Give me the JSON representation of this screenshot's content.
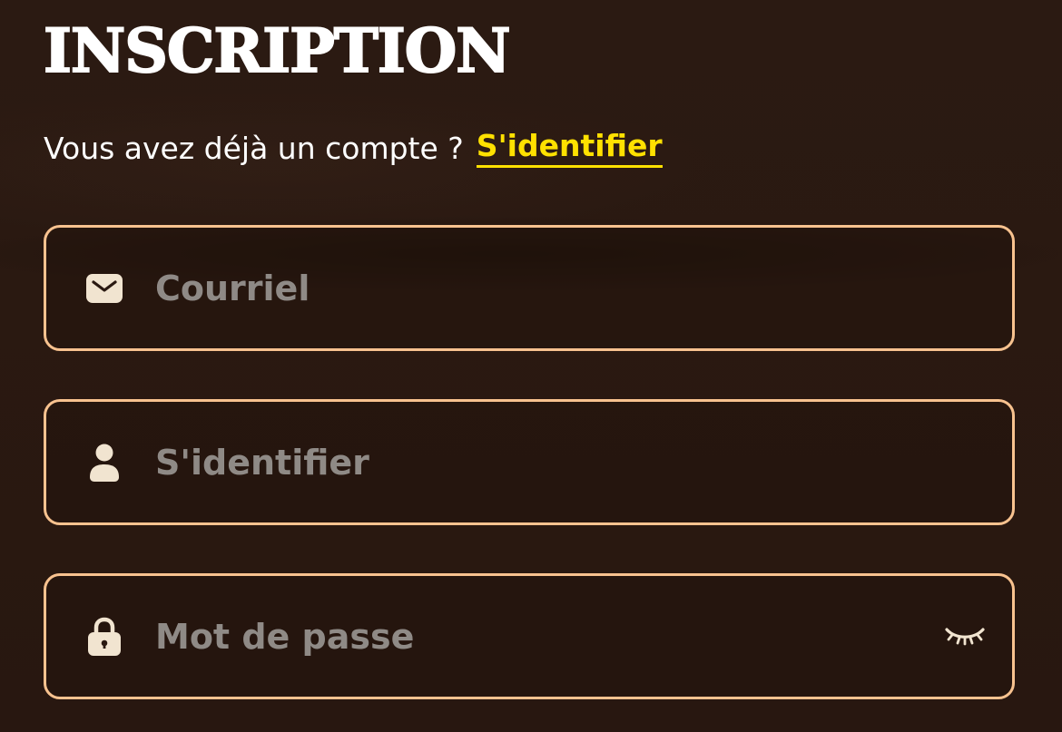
{
  "form": {
    "title": "INSCRIPTION",
    "login_prompt": "Vous avez déjà un compte ?",
    "login_link": "S'identifier"
  },
  "fields": {
    "email": {
      "placeholder": "Courriel",
      "value": "",
      "icon": "envelope-icon"
    },
    "username": {
      "placeholder": "S'identifier",
      "value": "",
      "icon": "user-icon"
    },
    "password": {
      "placeholder": "Mot de passe",
      "value": "",
      "icon": "lock-icon",
      "toggle_icon": "eye-closed-icon"
    }
  },
  "colors": {
    "background": "#2a1911",
    "accent": "#ffe100",
    "field_border": "#f8c28f",
    "icon": "#f1e4d0",
    "placeholder": "#8f8a86",
    "text": "#ffffff"
  }
}
